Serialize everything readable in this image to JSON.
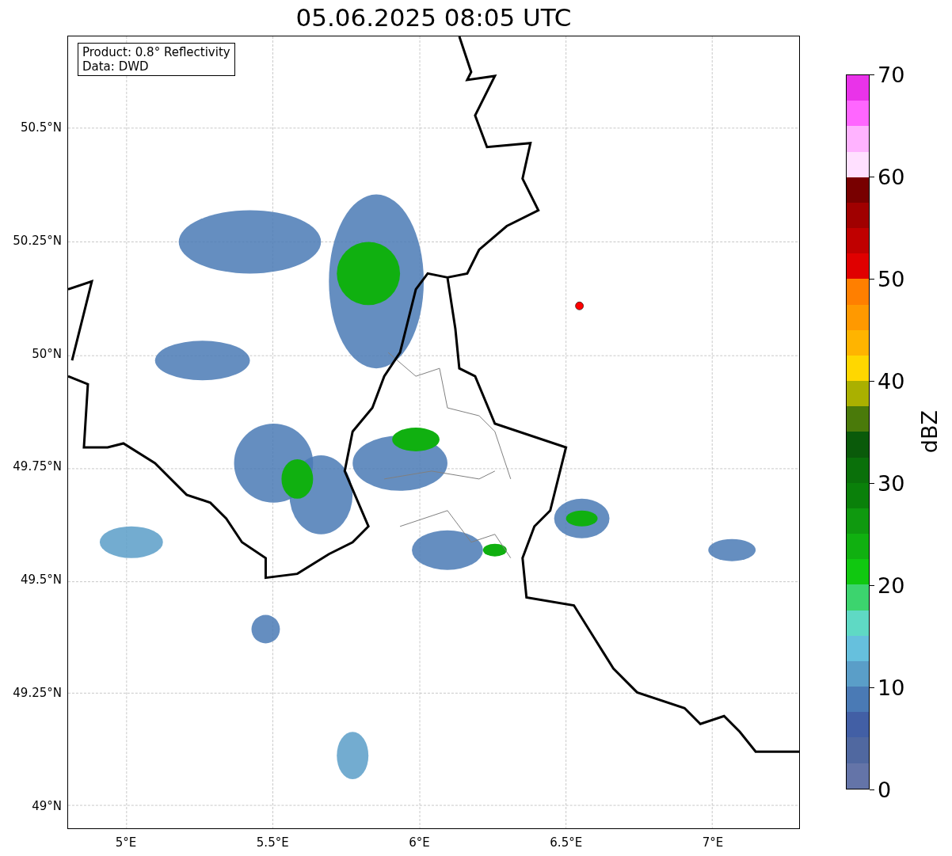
{
  "title": "05.06.2025 08:05 UTC",
  "info_box": {
    "lines": [
      "Product: 0.8° Reflectivity",
      "Data: DWD"
    ]
  },
  "y_axis": {
    "ticks": [
      "50.5°N",
      "50.25°N",
      "50°N",
      "49.75°N",
      "49.5°N",
      "49.25°N",
      "49°N"
    ]
  },
  "x_axis": {
    "ticks": [
      "5°E",
      "5.5°E",
      "6°E",
      "6.5°E",
      "7°E"
    ]
  },
  "colorbar": {
    "label": "dBZ",
    "ticks": [
      "70",
      "60",
      "50",
      "40",
      "30",
      "20",
      "10",
      "0"
    ],
    "segments": [
      {
        "color": "#e933e9"
      },
      {
        "color": "#ff66ff"
      },
      {
        "color": "#ffb3ff"
      },
      {
        "color": "#ffe0ff"
      },
      {
        "color": "#780000"
      },
      {
        "color": "#a00000"
      },
      {
        "color": "#c00000"
      },
      {
        "color": "#e00000"
      },
      {
        "color": "#ff7f00"
      },
      {
        "color": "#ff9900"
      },
      {
        "color": "#ffb400"
      },
      {
        "color": "#ffd700"
      },
      {
        "color": "#aab000"
      },
      {
        "color": "#4a7a0a"
      },
      {
        "color": "#0a5a0a"
      },
      {
        "color": "#0a700a"
      },
      {
        "color": "#0a800a"
      },
      {
        "color": "#0f990f"
      },
      {
        "color": "#10b010"
      },
      {
        "color": "#10c810"
      },
      {
        "color": "#3cd46e"
      },
      {
        "color": "#5fd9c4"
      },
      {
        "color": "#66c0dd"
      },
      {
        "color": "#5a9ec8"
      },
      {
        "color": "#4a7ab5"
      },
      {
        "color": "#425fa5"
      },
      {
        "color": "#5068a0"
      },
      {
        "color": "#6474a8"
      }
    ]
  }
}
